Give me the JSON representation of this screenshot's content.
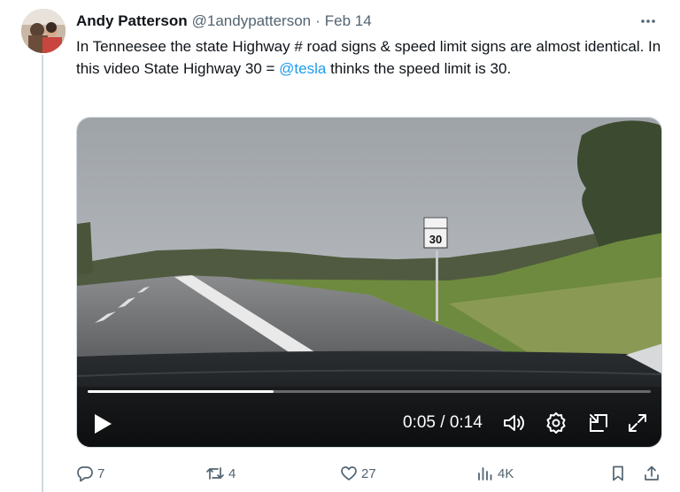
{
  "author": {
    "display_name": "Andy Patterson",
    "handle": "@1andypatterson",
    "separator": "·",
    "date": "Feb 14"
  },
  "tweet": {
    "text_before": "In Tenneesee the state Highway # road signs & speed limit signs are almost identical.  In this video State Highway 30 = ",
    "mention": "@tesla",
    "text_after": " thinks the speed limit is 30."
  },
  "video": {
    "current_time": "0:05",
    "time_separator": " / ",
    "duration": "0:14",
    "progress_fraction": 0.33,
    "sign_number": "30",
    "controls": [
      "play-icon",
      "volume-icon",
      "settings-icon",
      "picture-in-picture-icon",
      "fullscreen-icon"
    ]
  },
  "actions": {
    "replies": "7",
    "reposts": "4",
    "likes": "27",
    "views": "4K"
  },
  "colors": {
    "accent": "#1d9bf0",
    "secondary_text": "#536471",
    "primary_text": "#0f1419"
  }
}
